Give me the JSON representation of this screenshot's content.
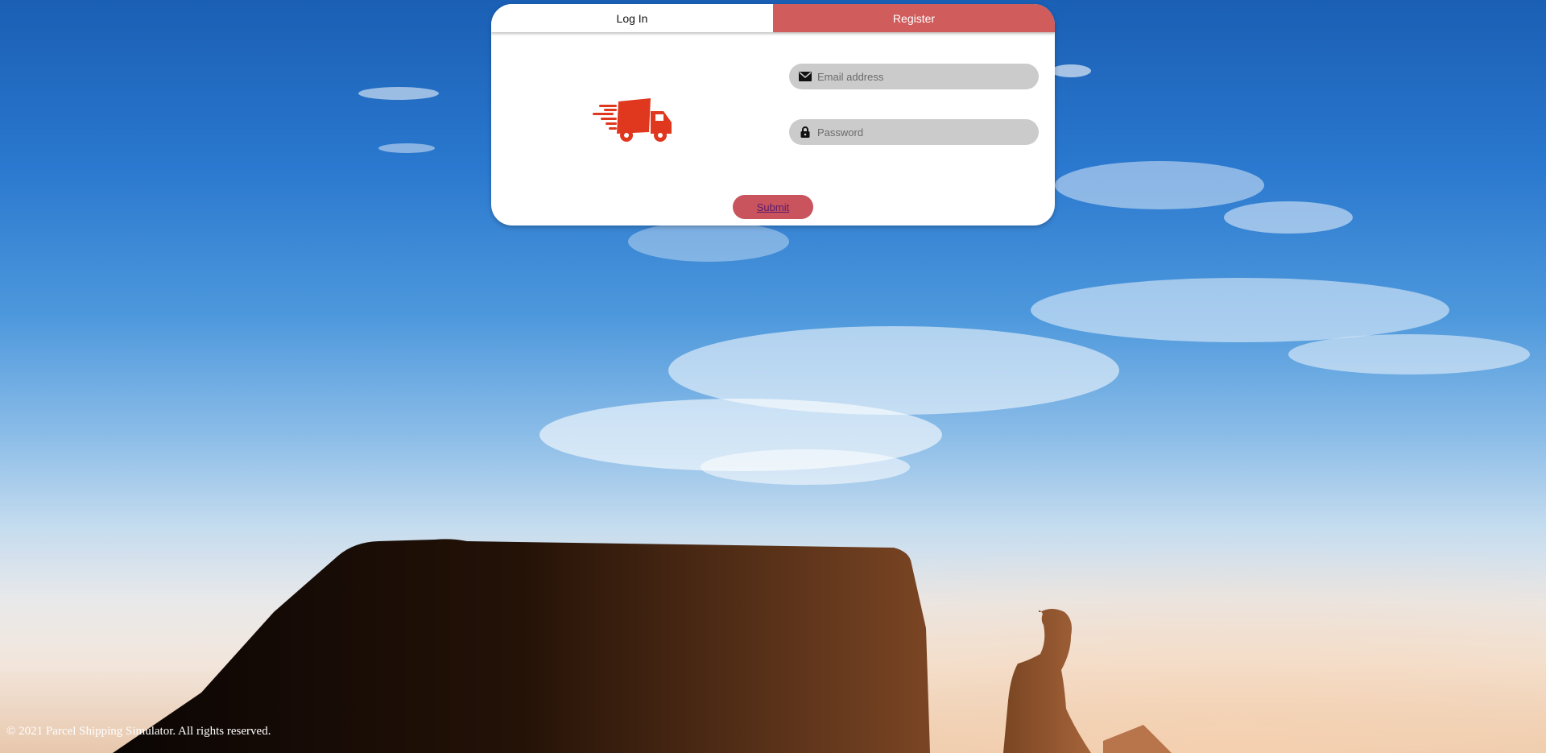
{
  "tabs": {
    "login_label": "Log In",
    "register_label": "Register"
  },
  "form": {
    "email_placeholder": "Email address",
    "password_placeholder": "Password",
    "submit_label": "Submit"
  },
  "logo": {
    "icon": "delivery-truck-icon",
    "color": "#e0371f"
  },
  "footer": {
    "text": "© 2021 Parcel Shipping Simulator. All rights reserved."
  },
  "colors": {
    "accent": "#d05c5c",
    "submit": "#c9545e",
    "field_bg": "#cbcbcb"
  }
}
